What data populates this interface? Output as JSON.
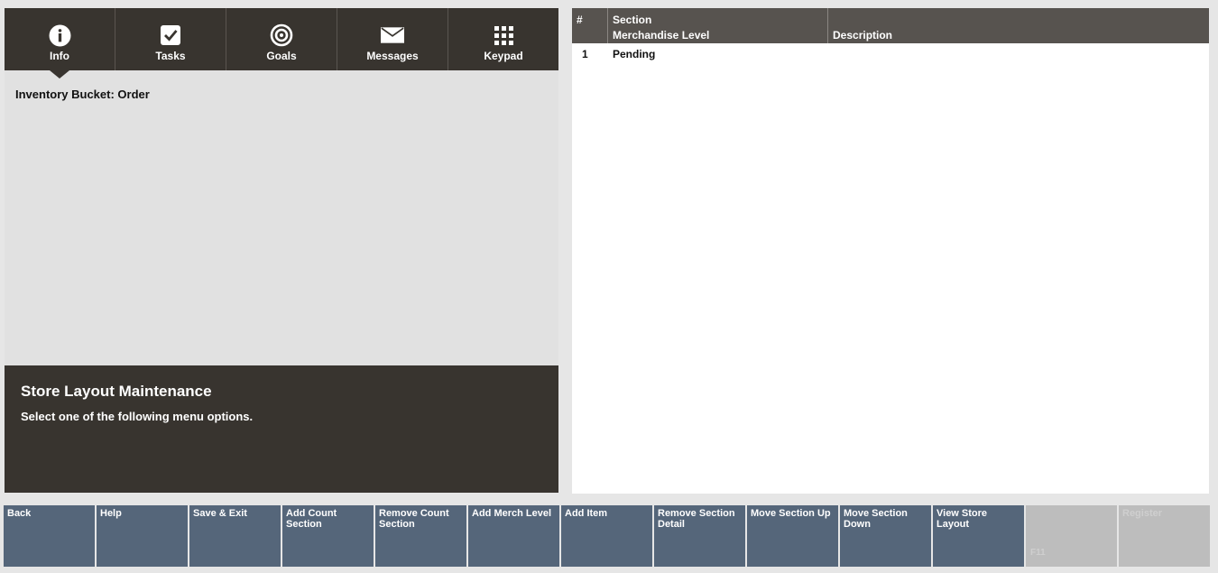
{
  "tabs": [
    {
      "label": "Info",
      "icon": "info-icon"
    },
    {
      "label": "Tasks",
      "icon": "checkbox-icon"
    },
    {
      "label": "Goals",
      "icon": "target-icon"
    },
    {
      "label": "Messages",
      "icon": "envelope-icon"
    },
    {
      "label": "Keypad",
      "icon": "keypad-icon"
    }
  ],
  "info": {
    "inventory_bucket": "Inventory Bucket:  Order"
  },
  "prompt": {
    "title": "Store Layout Maintenance",
    "text": "Select one of the following menu options."
  },
  "table": {
    "headers": {
      "num": "#",
      "section_line1": "Section",
      "section_line2": "Merchandise Level",
      "description": "Description"
    },
    "rows": [
      {
        "num": "1",
        "section": "Pending",
        "description": ""
      }
    ]
  },
  "function_keys": [
    {
      "label": "Back",
      "disabled": false
    },
    {
      "label": "Help",
      "disabled": false
    },
    {
      "label": "Save & Exit",
      "disabled": false
    },
    {
      "label": "Add Count Section",
      "disabled": false
    },
    {
      "label": "Remove Count Section",
      "disabled": false
    },
    {
      "label": "Add Merch Level",
      "disabled": false
    },
    {
      "label": "Add Item",
      "disabled": false
    },
    {
      "label": "Remove Section Detail",
      "disabled": false
    },
    {
      "label": "Move Section Up",
      "disabled": false
    },
    {
      "label": "Move Section Down",
      "disabled": false
    },
    {
      "label": "View Store Layout",
      "disabled": false
    },
    {
      "label": "",
      "key": "F11",
      "disabled": true
    },
    {
      "label": "Register",
      "disabled": true
    }
  ],
  "colors": {
    "dark_panel": "#38342f",
    "table_header": "#57534f",
    "function_key": "#55667a",
    "function_key_disabled": "#bdbdbd"
  }
}
